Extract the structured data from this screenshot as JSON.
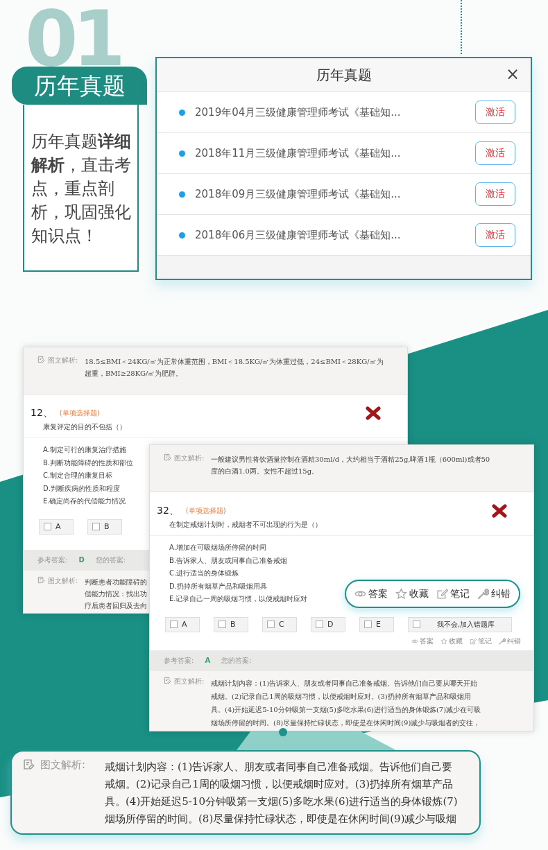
{
  "section_number": "01",
  "heading": "历年真题",
  "description": "历年真题**详细解析**，直击考点，重点剖析，巩固强化知识点！",
  "dialog": {
    "title": "历年真题",
    "close": "×",
    "items": [
      {
        "title": "2019年04月三级健康管理师考试《基础知...",
        "button": "激活"
      },
      {
        "title": "2018年11月三级健康管理师考试《基础知...",
        "button": "激活"
      },
      {
        "title": "2018年09月三级健康管理师考试《基础知...",
        "button": "激活"
      },
      {
        "title": "2018年06月三级健康管理师考试《基础知...",
        "button": "激活"
      }
    ]
  },
  "back_screen": {
    "top_explanation": {
      "label": "图文解析:",
      "lines": [
        "18.5≤BMI＜24KG/㎡为正常体重范围，BMI＜18.5KG/㎡为体重过低，24≤BMI＜28KG/㎡为",
        "超重，BMI≥28KG/㎡为肥胖。"
      ]
    },
    "question": {
      "number": "12、",
      "type": "(单项选择题)",
      "text": "康复评定的目的不包括（）",
      "options": [
        "A.制定可行的康复治疗措施",
        "B.判断功能障碍的性质和部位",
        "C.制定合理的康复目标",
        "D.判断疾病的性质和程度",
        "E.确定尚存的代偿能力情况"
      ]
    },
    "choices": [
      {
        "label": "A",
        "checked": false
      },
      {
        "label": "B",
        "checked": false
      }
    ],
    "reference": {
      "label": "参考答案:",
      "answer": "D",
      "your_label": "您的答案:"
    },
    "explanation": {
      "label": "图文解析:",
      "lines": [
        "判断患者功能障碍的",
        "偿能力情况：找出功",
        "疗后患者回归及去向"
      ]
    }
  },
  "front_screen": {
    "top_explanation": {
      "label": "图文解析:",
      "lines": [
        "一般建议男性将饮酒量控制在酒精30ml/d，大约相当于酒精25g,啤酒1瓶（600ml)或者50",
        "度的白酒1.0两。女性不超过15g。"
      ]
    },
    "question": {
      "number": "32、",
      "type": "(单项选择题)",
      "text": "在制定戒烟计划时，戒烟者不可出现的行为是（）",
      "options": [
        "A.增加在可吸烟场所停留的时间",
        "B.告诉家人、朋友或同事自己准备戒烟",
        "C.进行适当的身体锻炼",
        "D.扔掉所有烟草产品和吸烟用具",
        "E.记录自己一周的吸烟习惯，以便戒烟时应对"
      ]
    },
    "choices": [
      {
        "label": "A",
        "checked": false
      },
      {
        "label": "B",
        "checked": false
      },
      {
        "label": "C",
        "checked": false
      },
      {
        "label": "D",
        "checked": false
      },
      {
        "label": "E",
        "checked": false
      }
    ],
    "wrong_book": {
      "label": "我不会,加入错题库",
      "checked": false
    },
    "actions": [
      {
        "kind": "answer",
        "label": "答案"
      },
      {
        "kind": "favorite",
        "label": "收藏"
      },
      {
        "kind": "note",
        "label": "笔记"
      },
      {
        "kind": "report",
        "label": "纠错"
      }
    ],
    "reference": {
      "label": "参考答案:",
      "answer": "A",
      "your_label": "您的答案:"
    },
    "explanation": {
      "label": "图文解析:",
      "lines": [
        "戒烟计划内容：(1)告诉家人、朋友或者同事自己准备戒烟。告诉他们自己要从哪天开始",
        "戒烟。(2)记录自己1周的吸烟习惯，以便戒烟时应对。(3)扔掉所有烟草产品和吸烟用",
        "具。(4)开始延迟5-10分钟吸第一支烟(5)多吃水果(6)进行适当的身体锻炼(7)减少在可吸",
        "烟场所停留的时间。(8)尽量保持忙碌状态，即使是在休闲时间(9)减少与吸烟者的交往，"
      ]
    }
  },
  "callout": {
    "actions": [
      {
        "kind": "answer",
        "label": "答案"
      },
      {
        "kind": "favorite",
        "label": "收藏"
      },
      {
        "kind": "note",
        "label": "笔记"
      },
      {
        "kind": "report",
        "label": "纠错"
      }
    ]
  },
  "zoom_explanation": {
    "label": "图文解析:",
    "lines": [
      "戒烟计划内容：(1)告诉家人、朋友或者同事自己准备戒烟。告诉他们自己要",
      "戒烟。(2)记录自己1周的吸烟习惯，以便戒烟时应对。(3)扔掉所有烟草产品",
      "具。(4)开始延迟5-10分钟吸第一支烟(5)多吃水果(6)进行适当的身体锻炼(7)",
      "烟场所停留的时间。(8)尽量保持忙碌状态，即使是在休闲时间(9)减少与吸烟"
    ]
  }
}
